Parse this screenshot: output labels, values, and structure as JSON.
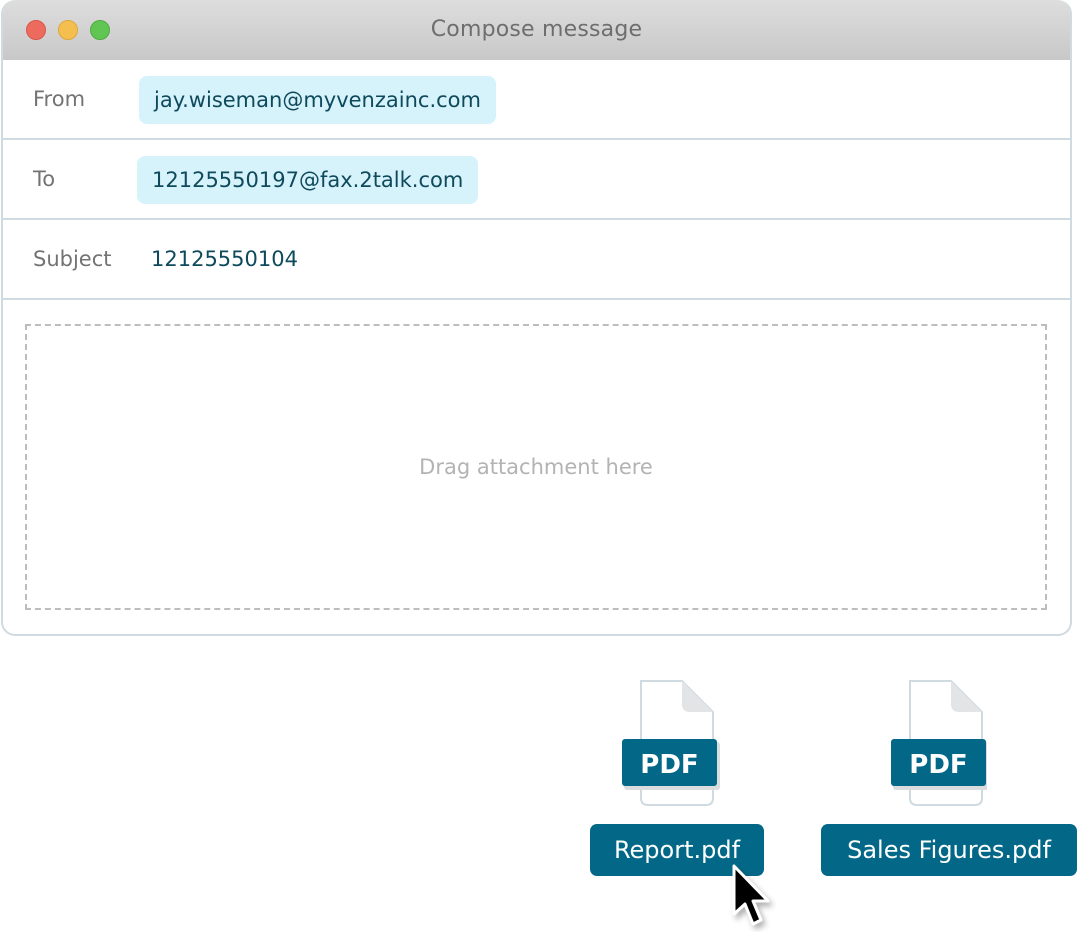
{
  "window": {
    "title": "Compose message",
    "controls": [
      "close",
      "minimize",
      "maximize"
    ],
    "traffic_colors": {
      "close": "#ed6a5e",
      "minimize": "#f4bf4f",
      "maximize": "#61c554"
    }
  },
  "compose": {
    "from": {
      "label": "From",
      "value": "jay.wiseman@myvenzainc.com"
    },
    "to": {
      "label": "To",
      "value": "12125550197@fax.2talk.com"
    },
    "subject": {
      "label": "Subject",
      "value": "12125550104"
    },
    "dropzone": {
      "placeholder": "Drag attachment here"
    }
  },
  "files": [
    {
      "name": "Report.pdf",
      "type_badge": "PDF",
      "icon": "pdf-file-icon"
    },
    {
      "name": "Sales Figures.pdf",
      "type_badge": "PDF",
      "icon": "pdf-file-icon"
    }
  ],
  "colors": {
    "accent": "#036887",
    "chip_bg": "#d6f2fb",
    "chip_text": "#0e4a5c",
    "border": "#cfdbe0"
  },
  "cursor": {
    "type": "arrow",
    "over": "Report.pdf"
  }
}
